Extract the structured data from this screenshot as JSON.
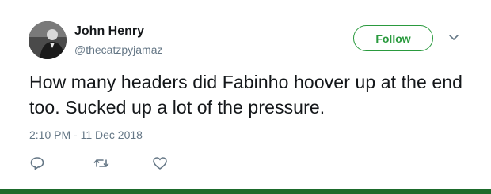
{
  "author": {
    "display_name": "John Henry",
    "handle": "@thecatzpyjamaz"
  },
  "follow_button": {
    "label": "Follow"
  },
  "tweet": {
    "text": "How many headers did Fabinho hoover up at the end too. Sucked up a lot of the pressure.",
    "timestamp": "2:10 PM - 11 Dec 2018"
  },
  "icons": {
    "avatar": "profile-photo",
    "caret": "chevron-down-icon",
    "reply": "reply-icon",
    "retweet": "retweet-icon",
    "like": "heart-icon"
  },
  "colors": {
    "accent": "#2a9a3e",
    "text": "#14171a",
    "secondary_text": "#657786",
    "bottom_bar": "#1d6b2c"
  }
}
